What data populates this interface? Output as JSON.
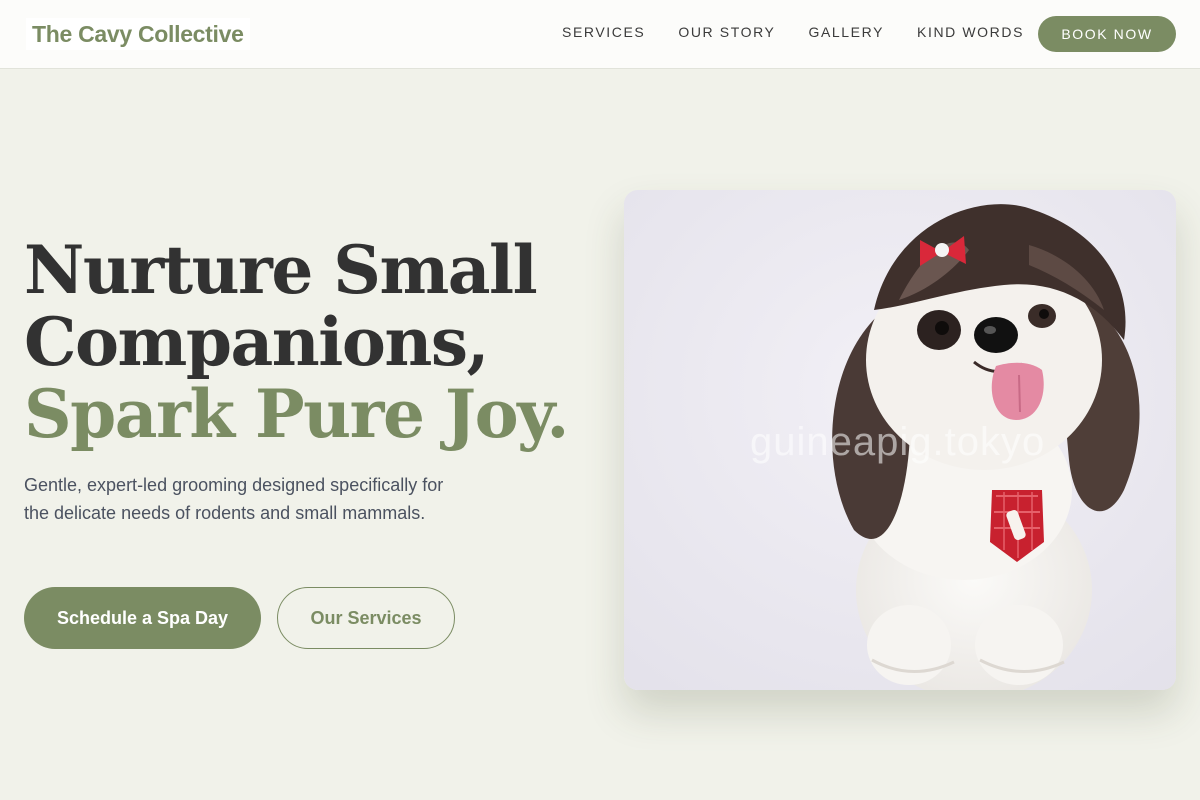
{
  "brand": {
    "name": "The Cavy Collective",
    "accent_color": "#7b8c63"
  },
  "nav": {
    "links": [
      "SERVICES",
      "OUR STORY",
      "GALLERY",
      "KIND WORDS"
    ],
    "cta_label": "BOOK NOW"
  },
  "hero": {
    "title_line1": "Nurture Small",
    "title_line2": "Companions,",
    "title_line3": "Spark Pure Joy.",
    "subtitle": "Gentle, expert-led grooming designed specifically for the delicate needs of rodents and small mammals.",
    "primary_button": "Schedule a Spa Day",
    "secondary_button": "Our Services",
    "image": {
      "subject": "small fluffy dog with red bow and red patterned tie",
      "watermark": "guineapig.tokyo"
    }
  }
}
